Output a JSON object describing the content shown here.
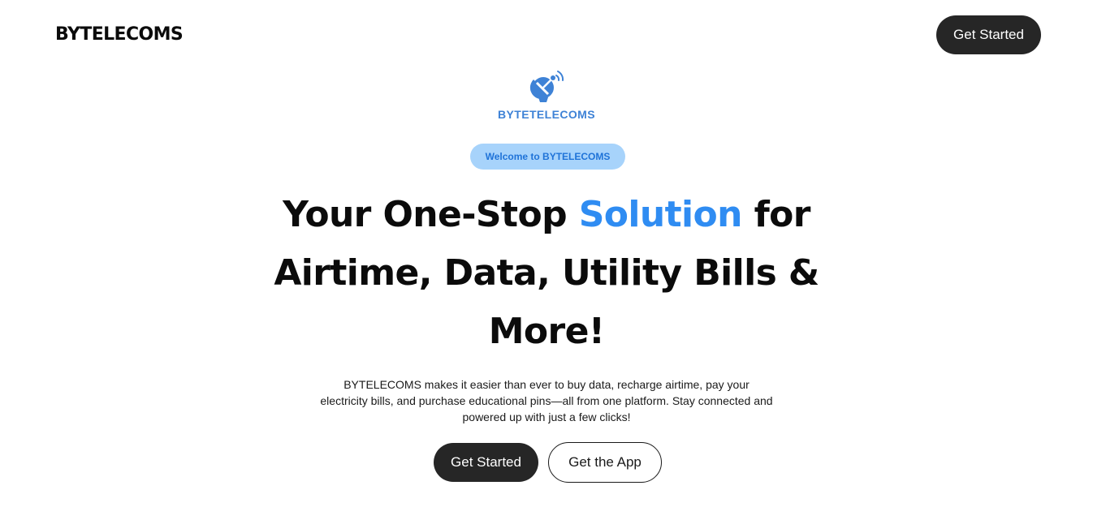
{
  "header": {
    "brand": "BYTELECOMS",
    "cta_label": "Get Started"
  },
  "logo": {
    "icon": "satellite-dish-icon",
    "text": "BYTETELECOMS"
  },
  "hero": {
    "badge": "Welcome to BYTELECOMS",
    "headline_before": "Your One-Stop ",
    "headline_accent": "Solution",
    "headline_after": " for Airtime, Data, Utility Bills & More!",
    "description": "BYTELECOMS makes it easier than ever to buy data, recharge airtime, pay your electricity bills, and purchase educational pins—all from one platform. Stay connected and powered up with just a few clicks!",
    "primary_button": "Get Started",
    "secondary_button": "Get the App"
  },
  "colors": {
    "accent": "#2f8cf2",
    "logo_blue": "#3e82d6",
    "badge_bg": "#a7d3fb",
    "badge_text": "#1f73d8",
    "dark_button": "#262626"
  }
}
